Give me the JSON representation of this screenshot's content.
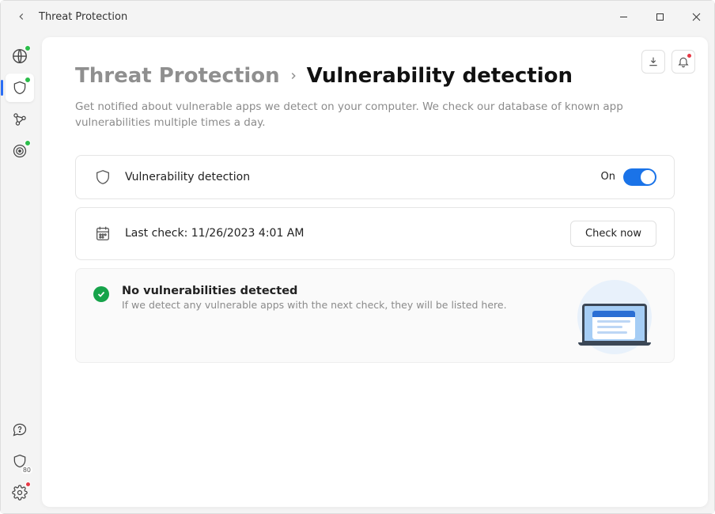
{
  "window": {
    "title": "Threat Protection"
  },
  "breadcrumb": {
    "parent": "Threat Protection",
    "current": "Vulnerability detection"
  },
  "description": "Get notified about vulnerable apps we detect on your computer. We check our database of known app vulnerabilities multiple times a day.",
  "detection_card": {
    "label": "Vulnerability detection",
    "state_text": "On"
  },
  "lastcheck_card": {
    "label": "Last check: 11/26/2023 4:01 AM",
    "button": "Check now"
  },
  "status": {
    "title": "No vulnerabilities detected",
    "subtitle": "If we detect any vulnerable apps with the next check, they will be listed here."
  },
  "sidebar": {
    "badge_count": "80"
  }
}
